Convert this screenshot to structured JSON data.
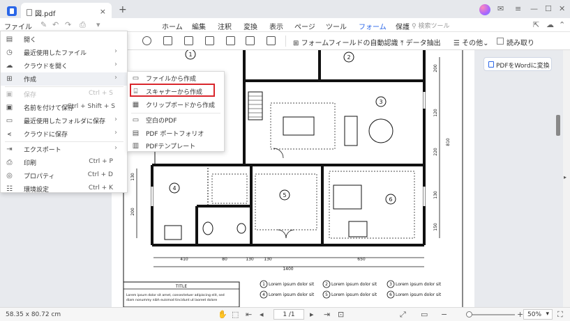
{
  "titlebar": {
    "tab_title": "図.pdf",
    "close_glyph": "×",
    "add_glyph": "+",
    "minimize_glyph": "—",
    "maximize_glyph": "☐",
    "window_close_glyph": "✕"
  },
  "menubar": {
    "file_label": "ファイル",
    "items": [
      "ホーム",
      "編集",
      "注釈",
      "変換",
      "表示",
      "ページ",
      "ツール",
      "フォーム",
      "保護"
    ],
    "active_item": "フォーム",
    "search_placeholder": "検索ツール"
  },
  "ribbon": {
    "auto_recognize": "フォームフィールドの自動認識",
    "data_extract": "データ抽出",
    "other": "その他",
    "readonly": "読み取り"
  },
  "file_menu": {
    "items": [
      {
        "label": "開く",
        "icon": "open-icon"
      },
      {
        "label": "最近使用したファイル",
        "icon": "clock-icon",
        "has_submenu": true
      },
      {
        "label": "クラウドを開く",
        "icon": "cloud-icon",
        "has_submenu": true
      },
      {
        "label": "作成",
        "icon": "plus-doc-icon",
        "has_submenu": true,
        "highlighted": true
      },
      {
        "label": "保存",
        "icon": "save-icon",
        "shortcut": "Ctrl + S",
        "disabled": true
      },
      {
        "label": "名前を付けて保存",
        "icon": "save-as-icon",
        "shortcut": "Ctrl + Shift + S"
      },
      {
        "label": "最近使用したフォルダに保存",
        "icon": "folder-icon",
        "has_submenu": true
      },
      {
        "label": "クラウドに保存",
        "icon": "share-icon",
        "has_submenu": true
      },
      {
        "label": "エクスポート",
        "icon": "export-icon",
        "has_submenu": true
      },
      {
        "label": "印刷",
        "icon": "print-icon",
        "shortcut": "Ctrl + P"
      },
      {
        "label": "プロパティ",
        "icon": "properties-icon",
        "shortcut": "Ctrl + D"
      },
      {
        "label": "環境設定",
        "icon": "settings-icon",
        "shortcut": "Ctrl + K"
      }
    ]
  },
  "create_submenu": {
    "items": [
      {
        "label": "ファイルから作成",
        "icon": "folder-icon"
      },
      {
        "label": "スキャナーから作成",
        "icon": "scanner-icon",
        "highlighted": true
      },
      {
        "label": "クリップボードから作成",
        "icon": "clipboard-icon"
      },
      {
        "label": "空白のPDF",
        "icon": "blank-doc-icon"
      },
      {
        "label": "PDF ポートフォリオ",
        "icon": "portfolio-icon"
      },
      {
        "label": "PDFテンプレート",
        "icon": "template-icon"
      }
    ]
  },
  "convert_button": "PDFをWordに変換",
  "floor_plan": {
    "rooms": [
      "1",
      "2",
      "3",
      "4",
      "5",
      "6"
    ],
    "dims_bottom": [
      "410",
      "80",
      "130",
      "130",
      "650"
    ],
    "total_width": "1400",
    "dims_right": [
      "200",
      "120",
      "220",
      "130",
      "150"
    ],
    "dims_left": [
      "130",
      "200"
    ],
    "right_total": "810",
    "title_label": "TITLE",
    "title_text_1": "Lorem ipsum dolor sit amet, consectetuer adipiscing elit, sed",
    "title_text_2": "diam nonummy nibh euismod tincidunt ut laoreet dolore",
    "legend": [
      {
        "num": "1",
        "text": "Lorem ipsum dolor sit"
      },
      {
        "num": "2",
        "text": "Lorem ipsum dolor sit"
      },
      {
        "num": "3",
        "text": "Lorem ipsum dolor sit"
      },
      {
        "num": "4",
        "text": "Lorem ipsum dolor sit"
      },
      {
        "num": "5",
        "text": "Lorem ipsum dolor sit"
      },
      {
        "num": "6",
        "text": "Lorem ipsum dolor sit"
      }
    ]
  },
  "statusbar": {
    "dimensions": "58.35 x 80.72 cm",
    "page_indicator": "1 /1",
    "zoom": "50%"
  }
}
